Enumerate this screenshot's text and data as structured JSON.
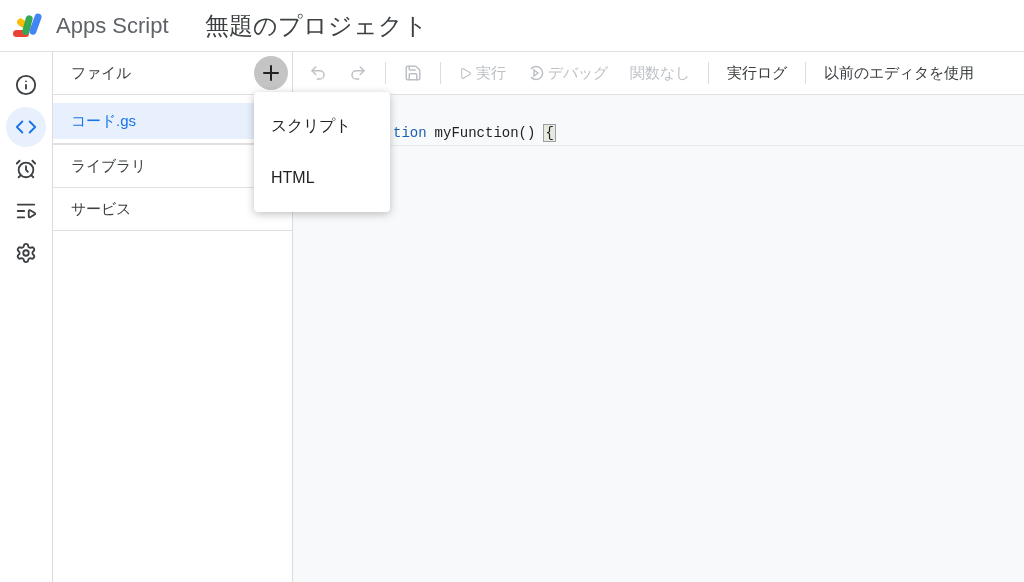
{
  "header": {
    "product": "Apps Script",
    "project_title": "無題のプロジェクト"
  },
  "rail": [
    {
      "kind": "info",
      "selected": false
    },
    {
      "kind": "code",
      "selected": true
    },
    {
      "kind": "clock",
      "selected": false
    },
    {
      "kind": "runs",
      "selected": false
    },
    {
      "kind": "settings",
      "selected": false
    }
  ],
  "files_panel": {
    "title": "ファイル",
    "files": [
      {
        "name": "コード.gs",
        "selected": true
      }
    ],
    "sections": [
      {
        "title": "ライブラリ"
      },
      {
        "title": "サービス"
      }
    ]
  },
  "toolbar": [
    {
      "kind": "undo",
      "disabled": true
    },
    {
      "kind": "redo",
      "disabled": true
    },
    {
      "kind": "divider"
    },
    {
      "kind": "save",
      "disabled": true
    },
    {
      "kind": "divider"
    },
    {
      "kind": "run",
      "label": "実行",
      "disabled": true
    },
    {
      "kind": "debug",
      "label": "デバッグ",
      "disabled": true
    },
    {
      "kind": "text",
      "label": "関数なし",
      "disabled": true
    },
    {
      "kind": "divider"
    },
    {
      "kind": "text",
      "label": "実行ログ",
      "disabled": false
    },
    {
      "kind": "divider"
    },
    {
      "kind": "text",
      "label": "以前のエディタを使用",
      "disabled": false
    }
  ],
  "code_line": [
    {
      "kind": "keyword",
      "text": "tion"
    },
    {
      "kind": "plain",
      "text": "myFunction()"
    },
    {
      "kind": "bracket",
      "text": "{"
    }
  ],
  "add_menu": {
    "items": [
      {
        "label": "スクリプト"
      },
      {
        "label": "HTML"
      }
    ]
  }
}
